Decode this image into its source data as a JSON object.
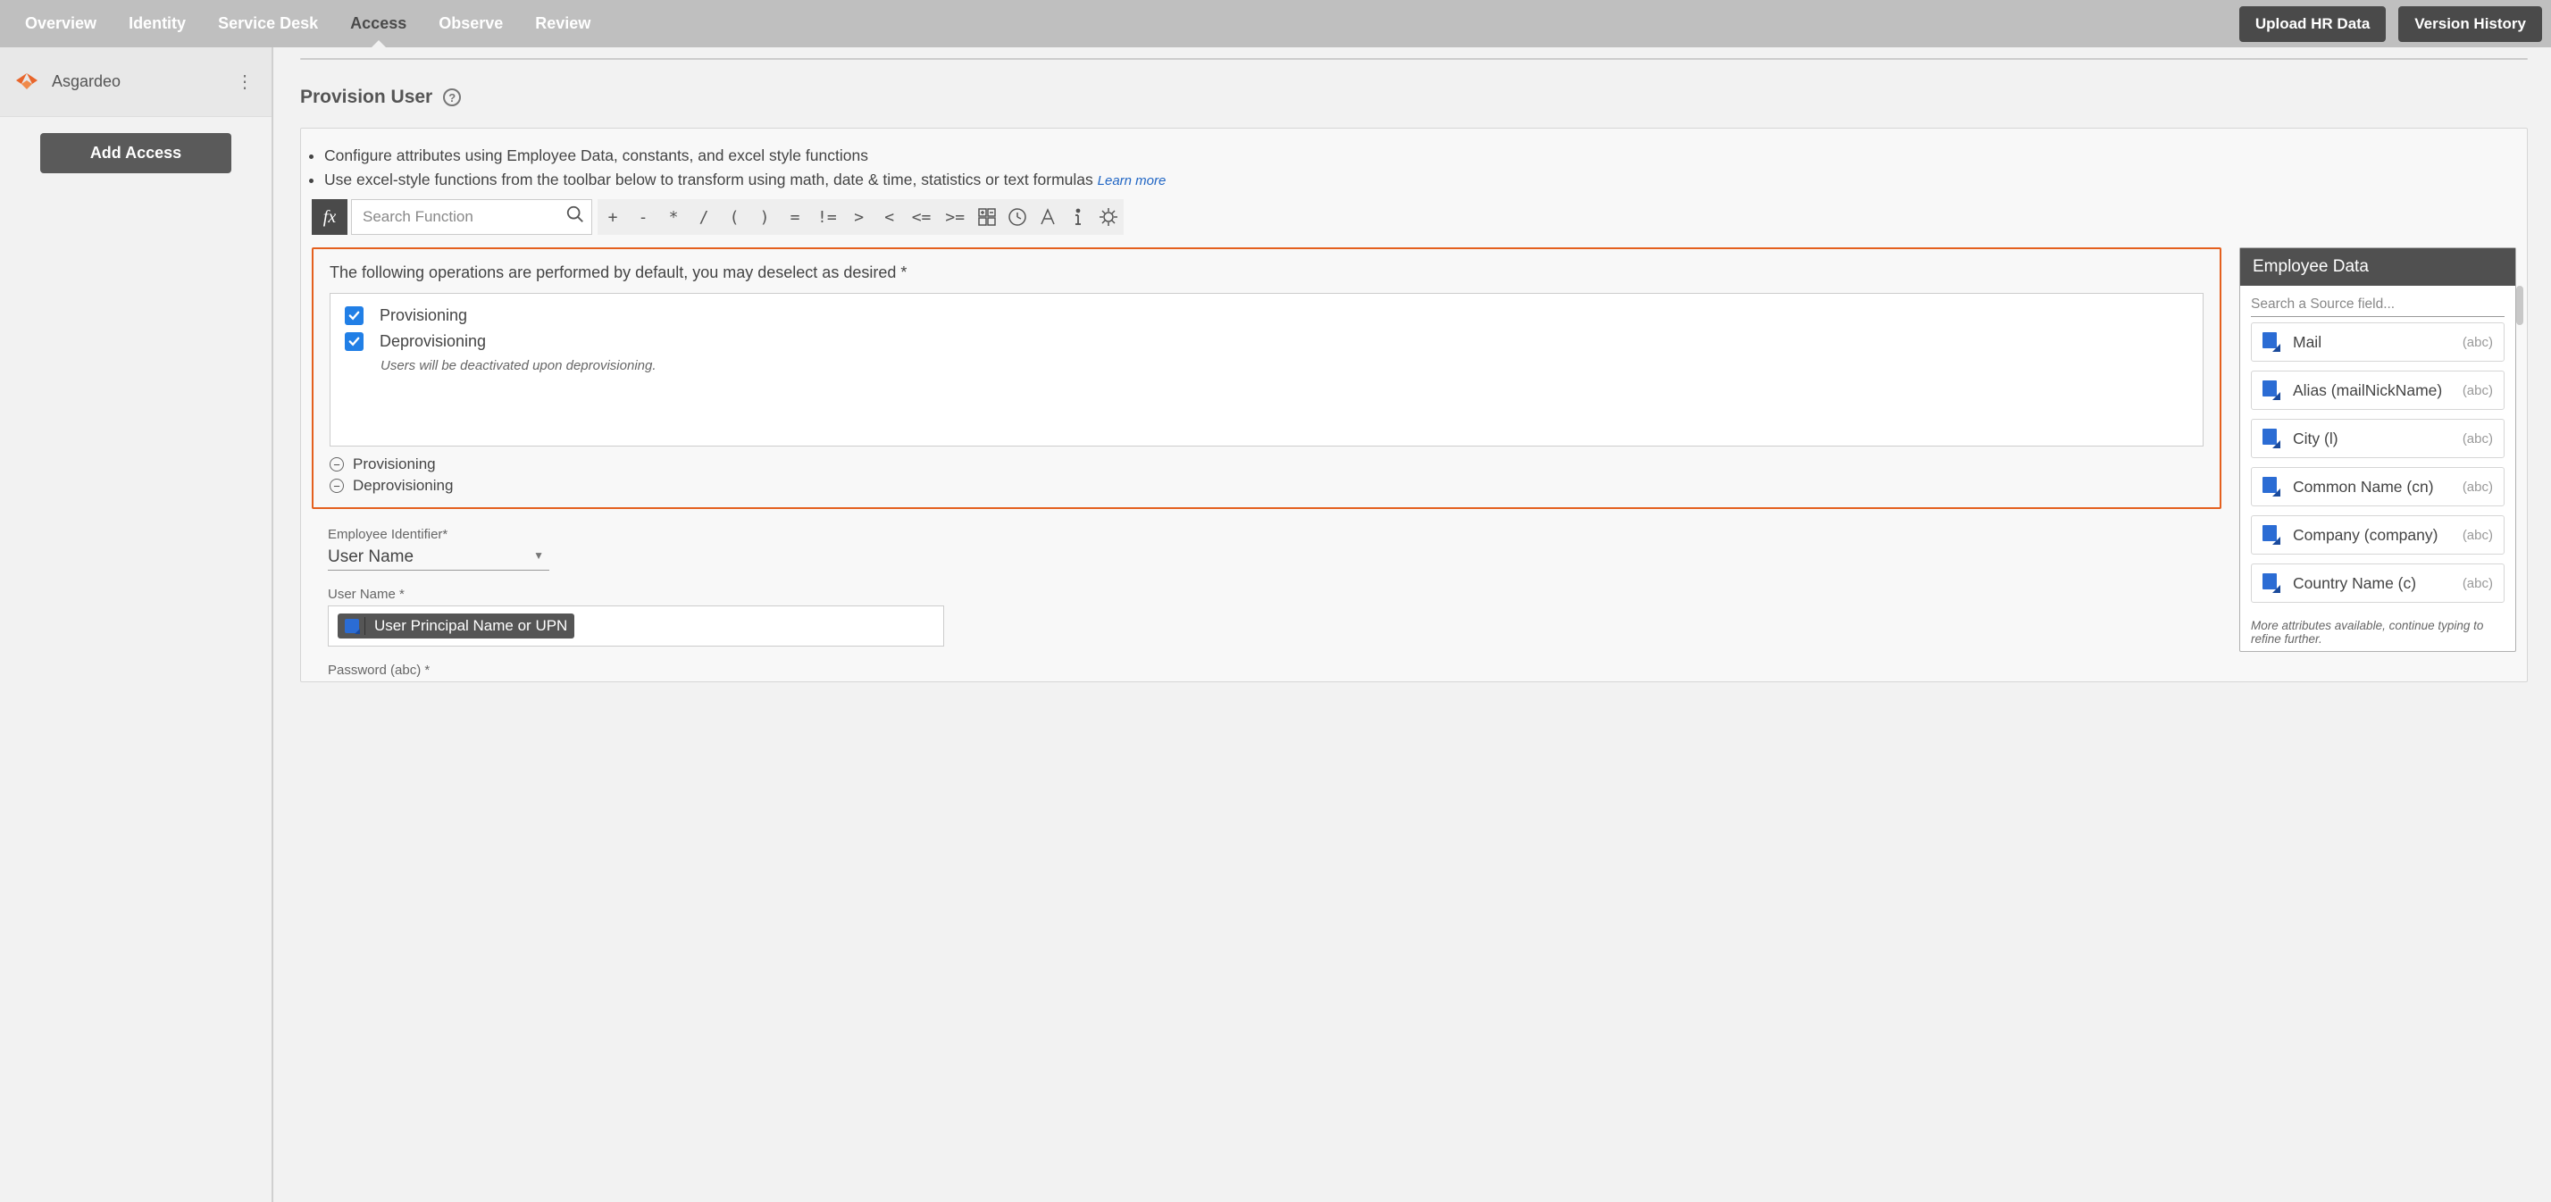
{
  "nav": {
    "tabs": [
      "Overview",
      "Identity",
      "Service Desk",
      "Access",
      "Observe",
      "Review"
    ],
    "active_index": 3,
    "upload_btn": "Upload HR Data",
    "version_btn": "Version History"
  },
  "sidebar": {
    "app_name": "Asgardeo",
    "add_access_btn": "Add Access"
  },
  "section": {
    "title": "Provision User"
  },
  "config_intro": {
    "li1": "Configure attributes using Employee Data, constants, and excel style functions",
    "li2": "Use excel-style functions from the toolbar below to transform using math, date & time, statistics or text formulas",
    "learn_more": "Learn more"
  },
  "toolbar": {
    "fx": "fx",
    "search_placeholder": "Search Function",
    "ops": [
      "+",
      "-",
      "*",
      "/",
      "(",
      ")",
      "=",
      "!=",
      ">",
      "<",
      "<=",
      ">="
    ]
  },
  "highlight": {
    "intro": "The following operations are performed by default, you may deselect as desired *",
    "op1": "Provisioning",
    "op2": "Deprovisioning",
    "note": "Users will be deactivated upon deprovisioning.",
    "collapse1": "Provisioning",
    "collapse2": "Deprovisioning"
  },
  "fields": {
    "emp_id_label": "Employee Identifier*",
    "emp_id_value": "User Name",
    "username_label": "User Name *",
    "username_token": "User Principal Name or UPN",
    "password_label": "Password (abc) *"
  },
  "emp_panel": {
    "title": "Employee Data",
    "search_placeholder": "Search a Source field...",
    "type_hint": "(abc)",
    "items": [
      "Mail",
      "Alias (mailNickName)",
      "City (l)",
      "Common Name (cn)",
      "Company (company)",
      "Country Name (c)"
    ],
    "more": "More attributes available, continue typing to refine further."
  }
}
